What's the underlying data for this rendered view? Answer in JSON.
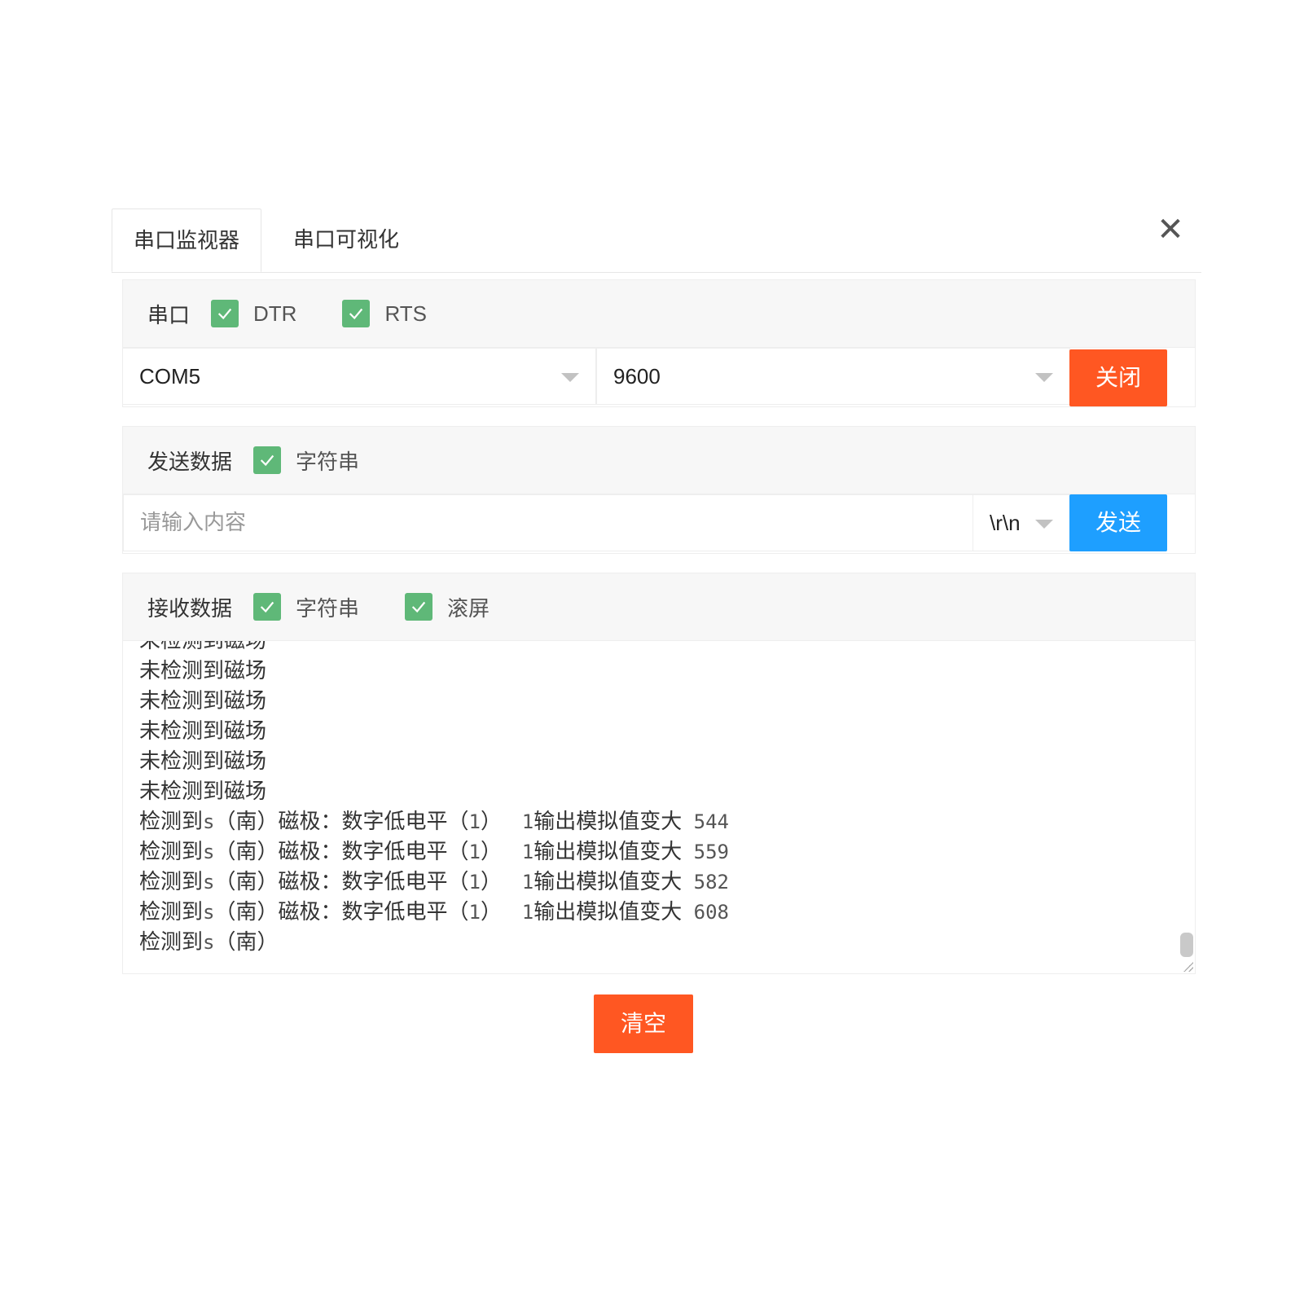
{
  "tabs": {
    "monitor": "串口监视器",
    "visual": "串口可视化"
  },
  "close_icon": "✕",
  "serial": {
    "header_label": "串口",
    "dtr_label": "DTR",
    "rts_label": "RTS",
    "port_value": "COM5",
    "baud_value": "9600",
    "close_button": "关闭"
  },
  "send": {
    "header_label": "发送数据",
    "string_label": "字符串",
    "input_placeholder": "请输入内容",
    "line_ending": "\\r\\n",
    "send_button": "发送"
  },
  "receive": {
    "header_label": "接收数据",
    "string_label": "字符串",
    "scroll_label": "滚屏",
    "lines": [
      {
        "cn": "未检测到磁场"
      },
      {
        "cn": "未检测到磁场"
      },
      {
        "cn": "未检测到磁场"
      },
      {
        "cn": "未检测到磁场"
      },
      {
        "cn": "未检测到磁场"
      },
      {
        "cn": "未检测到磁场"
      },
      {
        "a": "检测到",
        "b": "s",
        "c": "（南）磁极：数字低电平（",
        "d": "1",
        "e": "）   ",
        "f": "1",
        "g": "输出模拟值变大",
        "h": " 544"
      },
      {
        "a": "检测到",
        "b": "s",
        "c": "（南）磁极：数字低电平（",
        "d": "1",
        "e": "）   ",
        "f": "1",
        "g": "输出模拟值变大",
        "h": " 559"
      },
      {
        "a": "检测到",
        "b": "s",
        "c": "（南）磁极：数字低电平（",
        "d": "1",
        "e": "）   ",
        "f": "1",
        "g": "输出模拟值变大",
        "h": " 582"
      },
      {
        "a": "检测到",
        "b": "s",
        "c": "（南）磁极：数字低电平（",
        "d": "1",
        "e": "）   ",
        "f": "1",
        "g": "输出模拟值变大",
        "h": " 608"
      },
      {
        "a": "检测到",
        "b": "s",
        "c": "（南）",
        "d": "",
        "e": "",
        "f": "",
        "g": "",
        "h": ""
      }
    ]
  },
  "clear_button": "清空",
  "colors": {
    "orange": "#ff5722",
    "blue": "#1e9fff",
    "checkbox_green": "#5fb878"
  }
}
